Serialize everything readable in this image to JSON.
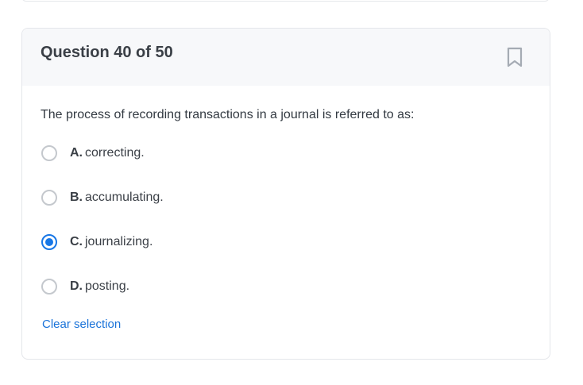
{
  "question": {
    "title": "Question 40 of 50",
    "text": "The process of recording transactions in a journal is referred to as:",
    "bookmark_icon": "bookmark-icon",
    "options": [
      {
        "letter": "A.",
        "text": "correcting.",
        "selected": false
      },
      {
        "letter": "B.",
        "text": "accumulating.",
        "selected": false
      },
      {
        "letter": "C.",
        "text": "journalizing.",
        "selected": true
      },
      {
        "letter": "D.",
        "text": "posting.",
        "selected": false
      }
    ],
    "clear_label": "Clear selection"
  },
  "colors": {
    "accent": "#1877e6",
    "link": "#1a73d9",
    "header_bg": "#f7f8fa",
    "text": "#3a3f46"
  }
}
